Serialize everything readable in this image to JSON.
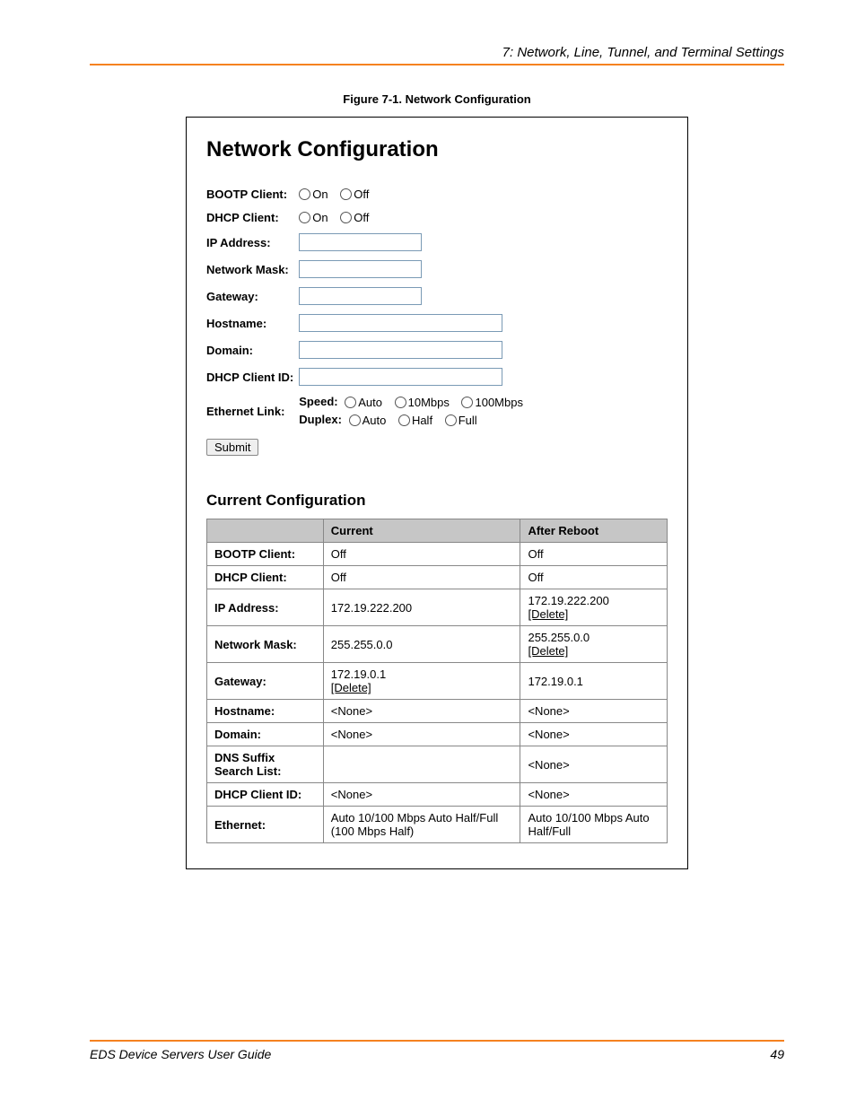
{
  "header": {
    "chapter": "7: Network, Line, Tunnel, and Terminal Settings"
  },
  "figure": {
    "caption": "Figure 7-1. Network Configuration",
    "title": "Network Configuration"
  },
  "form": {
    "bootp_label": "BOOTP Client:",
    "dhcp_label": "DHCP Client:",
    "on_label": "On",
    "off_label": "Off",
    "ip_label": "IP Address:",
    "mask_label": "Network Mask:",
    "gateway_label": "Gateway:",
    "hostname_label": "Hostname:",
    "domain_label": "Domain:",
    "dhcp_id_label": "DHCP Client ID:",
    "eth_label": "Ethernet Link:",
    "speed_label": "Speed:",
    "speed_auto": "Auto",
    "speed_10": "10Mbps",
    "speed_100": "100Mbps",
    "duplex_label": "Duplex:",
    "duplex_auto": "Auto",
    "duplex_half": "Half",
    "duplex_full": "Full",
    "submit": "Submit"
  },
  "current": {
    "title": "Current Configuration",
    "col_blank": "",
    "col_current": "Current",
    "col_after": "After Reboot",
    "rows": {
      "bootp": {
        "label": "BOOTP Client:",
        "current": "Off",
        "after": "Off"
      },
      "dhcpcli": {
        "label": "DHCP Client:",
        "current": "Off",
        "after": "Off"
      },
      "ip": {
        "label": "IP Address:",
        "current": "172.19.222.200",
        "after_val": "172.19.222.200",
        "after_link": "[Delete]"
      },
      "mask": {
        "label": "Network Mask:",
        "current": "255.255.0.0",
        "after_val": "255.255.0.0",
        "after_link": "[Delete]"
      },
      "gateway": {
        "label": "Gateway:",
        "current_val": "172.19.0.1",
        "current_link": "[Delete]",
        "after": "172.19.0.1"
      },
      "host": {
        "label": "Hostname:",
        "current": "<None>",
        "after": "<None>"
      },
      "domain": {
        "label": "Domain:",
        "current": "<None>",
        "after": "<None>"
      },
      "dns": {
        "label": "DNS Suffix Search List:",
        "current": "",
        "after": "<None>"
      },
      "dhcpid": {
        "label": "DHCP Client ID:",
        "current": "<None>",
        "after": "<None>"
      },
      "eth": {
        "label": "Ethernet:",
        "current": "Auto 10/100 Mbps Auto Half/Full (100 Mbps Half)",
        "after": "Auto 10/100 Mbps Auto Half/Full"
      }
    }
  },
  "footer": {
    "guide": "EDS Device Servers User Guide",
    "page": "49"
  }
}
